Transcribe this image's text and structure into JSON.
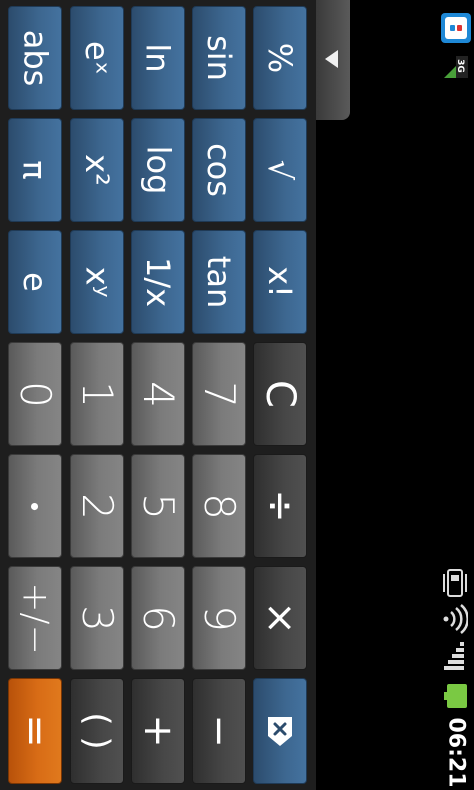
{
  "keypad": {
    "advanced_rows": [
      [
        "abs",
        "π",
        "e"
      ],
      [
        "eˣ",
        "x²",
        "xʸ"
      ],
      [
        "ln",
        "log",
        "1/x"
      ],
      [
        "sin",
        "cos",
        "tan"
      ],
      [
        "%",
        "√",
        "x!"
      ]
    ],
    "digits": {
      "d0": "0",
      "d1": "1",
      "d2": "2",
      "d3": "3",
      "d4": "4",
      "d5": "5",
      "d6": "6",
      "d7": "7",
      "d8": "8",
      "d9": "9"
    },
    "dot": "•",
    "plus_minus": "+/−",
    "clear": "C",
    "divide": "÷",
    "multiply": "×",
    "equals": "=",
    "parens": "( )",
    "plus": "+",
    "minus": "−"
  },
  "status": {
    "time": "06:21",
    "network": "3G"
  },
  "colors": {
    "advanced_key": "#3d6790",
    "number_key": "#7b7b7b",
    "operator_key": "#474747",
    "equals_key": "#d86c16",
    "battery": "#7ac943"
  }
}
